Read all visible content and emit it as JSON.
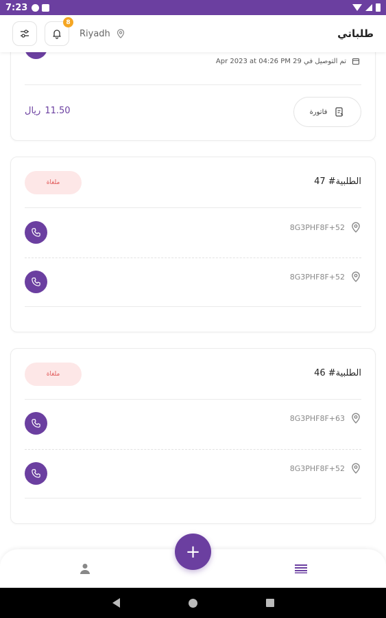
{
  "status_bar": {
    "time": "7:23"
  },
  "header": {
    "city": "Riyadh",
    "title": "طلباتي",
    "notification_count": "8"
  },
  "top_card": {
    "delivered_text": "تم التوصيل في 29 Apr 2023 at 04:26 PM",
    "price_value": "11.50",
    "price_currency": "ريال",
    "invoice_label": "فاتورة"
  },
  "orders": [
    {
      "title": "الطلبية# 47",
      "status": "ملغاة",
      "pickup": "8G3PHF8F+52",
      "dropoff": "8G3PHF8F+52"
    },
    {
      "title": "الطلبية# 46",
      "status": "ملغاة",
      "pickup": "8G3PHF8F+63",
      "dropoff": "8G3PHF8F+52"
    }
  ],
  "fab_label": "+",
  "colors": {
    "brand": "#6b3fa0",
    "badge": "#f5a623",
    "cancelled_bg": "#fde7e7",
    "cancelled_text": "#e05a5a"
  }
}
